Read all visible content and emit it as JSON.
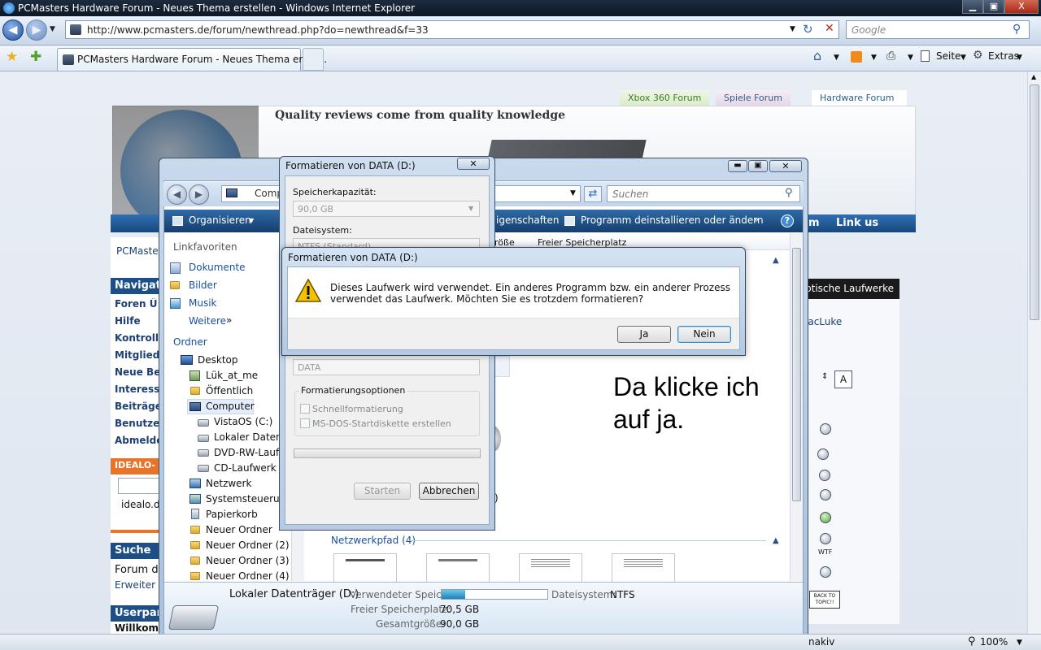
{
  "window": {
    "title": "PCMasters Hardware Forum - Neues Thema erstellen - Windows Internet Explorer",
    "min": "▁",
    "max": "▣",
    "close": "X"
  },
  "browser": {
    "address": "http://www.pcmasters.de/forum/newthread.php?do=newthread&f=33",
    "search_placeholder": "Google",
    "tab_title": "PCMasters Hardware Forum - Neues Thema erste...",
    "toolbar": {
      "page": "Seite",
      "extras": "Extras"
    },
    "status": {
      "text": "nakiv",
      "zoom": "100%"
    }
  },
  "forum": {
    "tabs": [
      "Xbox 360 Forum",
      "Spiele Forum",
      "Hardware Forum"
    ],
    "tagline": "Quality reviews come from quality knowledge",
    "nav_link": "Link us",
    "nav_frag": "m",
    "breadcrumb": "PCMaster",
    "sidebar_header": "Navigat",
    "sidebar_links": [
      "Foren Ü",
      "Hilfe",
      "Kontroll",
      "Mitglied",
      "Neue Be",
      "Interess",
      "Beiträge",
      "Benutze",
      "Abmelde"
    ],
    "idealo_header": "IDEALO-",
    "idealo_text": "idealo.d",
    "suche_header": "Suche",
    "suche_text": "Forum d",
    "suche_link": "Erweiter",
    "user_header": "Userpan",
    "welcome": "Willkom",
    "right_header": "ptische Laufwerke",
    "right_user": "lacLuke",
    "smileys": [
      {
        "label": ""
      },
      {
        "label": ""
      },
      {
        "label": ""
      },
      {
        "label": ""
      },
      {
        "label": ""
      },
      {
        "label": "WTF"
      },
      {
        "label": ""
      },
      {
        "label": "BACK TO TOPIC!!"
      }
    ]
  },
  "explorer": {
    "address_frag": "Comp",
    "search_placeholder": "Suchen",
    "toolbar": {
      "organize": "Organisieren",
      "properties": "igenschaften",
      "uninstall": "Programm deinstallieren oder ändern",
      "more": "»"
    },
    "favorites_header": "Linkfavoriten",
    "favorites": [
      "Dokumente",
      "Bilder",
      "Musik"
    ],
    "more": "Weitere",
    "folders_header": "Ordner",
    "tree": [
      {
        "label": "Desktop",
        "icon": "desktop-icon"
      },
      {
        "label": "Lük_at_me",
        "icon": "user-icon"
      },
      {
        "label": "Öffentlich",
        "icon": "folder-icon"
      },
      {
        "label": "Computer",
        "icon": "computer-icon"
      },
      {
        "label": "VistaOS (C:)",
        "icon": "drive-icon"
      },
      {
        "label": "Lokaler Datentr",
        "icon": "drive-icon"
      },
      {
        "label": "DVD-RW-Laufw",
        "icon": "optical-drive-icon"
      },
      {
        "label": "CD-Laufwerk (F",
        "icon": "optical-drive-icon"
      },
      {
        "label": "Netzwerk",
        "icon": "network-icon"
      },
      {
        "label": "Systemsteuerung",
        "icon": "control-panel-icon"
      },
      {
        "label": "Papierkorb",
        "icon": "recycle-bin-icon"
      },
      {
        "label": "Neuer Ordner",
        "icon": "folder-icon"
      },
      {
        "label": "Neuer Ordner (2)",
        "icon": "folder-icon"
      },
      {
        "label": "Neuer Ordner (3)",
        "icon": "folder-icon"
      },
      {
        "label": "Neuer Ordner (4)",
        "icon": "folder-icon"
      }
    ],
    "columns": [
      "röße",
      "Freier Speicherplatz"
    ],
    "col_frag": "er",
    "item_frag": ")",
    "network_group": "Netzwerkpfad (4)",
    "details": {
      "name": "Lokaler Datenträger (D:)",
      "used_label": "Verwendeter Speic...",
      "used_fraction": 0.22,
      "fs_label": "Dateisystem:",
      "fs_value": "NTFS",
      "free_label": "Freier Speicherplatz:",
      "free_value": "70,5 GB",
      "total_label": "Gesamtgröße:",
      "total_value": "90,0 GB"
    }
  },
  "format_dialog": {
    "title": "Formatieren von DATA (D:)",
    "capacity_label": "Speicherkapazität:",
    "capacity_value": "90,0 GB",
    "fs_label": "Dateisystem:",
    "fs_value": "NTFS (Standard)",
    "volume_value": "DATA",
    "options_label": "Formatierungsoptionen",
    "quick": "Schnellformatierung",
    "msdos": "MS-DOS-Startdiskette erstellen",
    "start": "Starten",
    "cancel": "Abbrechen"
  },
  "confirm_dialog": {
    "title": "Formatieren von DATA (D:)",
    "message": "Dieses Laufwerk wird verwendet. Ein anderes Programm bzw. ein anderer Prozess verwendet das Laufwerk. Möchten Sie es trotzdem formatieren?",
    "yes": "Ja",
    "no": "Nein"
  },
  "annotation": "Da klicke ich auf ja.",
  "colors": {
    "ie_title": "#0d1825",
    "forum_nav": "#17487e",
    "warning": "#f2c200"
  }
}
